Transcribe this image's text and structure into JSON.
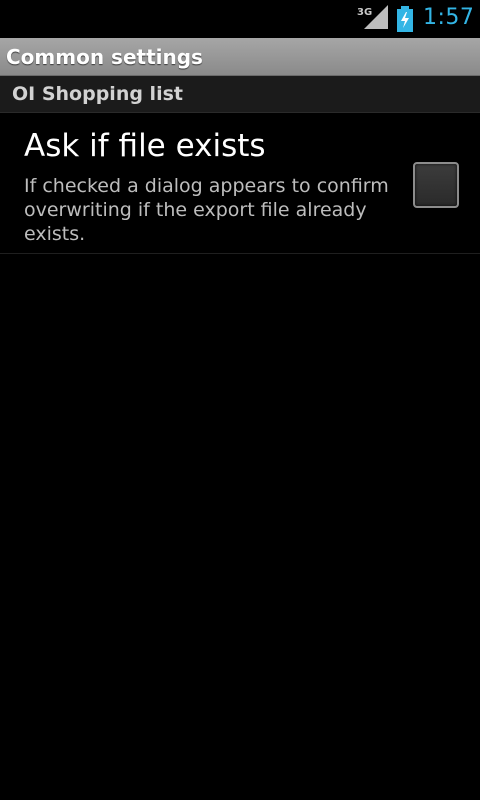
{
  "status_bar": {
    "network_type": "3G",
    "time": "1:57",
    "icons": {
      "signal": "signal-strength-icon",
      "battery": "battery-charging-icon"
    },
    "clock_color": "#33b5e5"
  },
  "title_bar": {
    "title": "Common settings"
  },
  "category": {
    "label": "OI Shopping list"
  },
  "preference": {
    "title": "Ask if file exists",
    "summary": "If checked a dialog appears to confirm overwriting if the export file already exists.",
    "checked": false
  }
}
